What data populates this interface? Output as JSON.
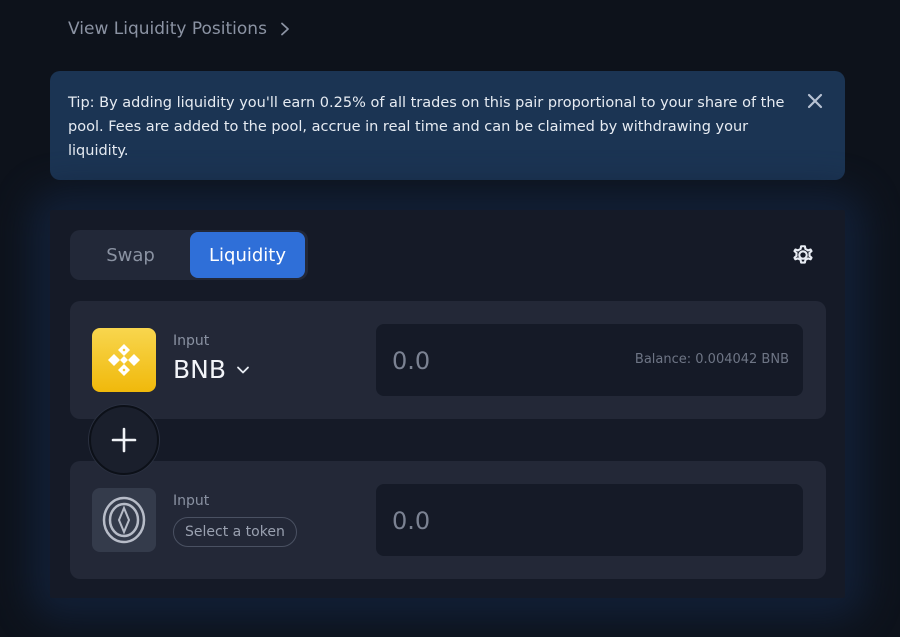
{
  "top_link": {
    "label": "View Liquidity Positions",
    "icon": "chevron-right-icon"
  },
  "tip": {
    "text": "Tip: By adding liquidity you'll earn 0.25% of all trades on this pair proportional to your share of the pool. Fees are added to the pool, accrue in real time and can be claimed by withdrawing your liquidity.",
    "close_icon": "close-icon"
  },
  "tabs": [
    {
      "label": "Swap",
      "active": false
    },
    {
      "label": "Liquidity",
      "active": true
    }
  ],
  "settings_icon": "gear-icon",
  "inputs": [
    {
      "label": "Input",
      "token": "BNB",
      "token_icon": "bnb-icon",
      "amount_placeholder": "0.0",
      "balance": "Balance: 0.004042 BNB"
    },
    {
      "label": "Input",
      "select_label": "Select a token",
      "token_icon": "unknown-token-icon",
      "amount_placeholder": "0.0"
    }
  ],
  "add_icon": "plus-icon",
  "colors": {
    "background": "#0d121b",
    "tip_background": "#1b3453",
    "accent": "#2f6fd8",
    "bnb_yellow": "#f0b90b"
  }
}
